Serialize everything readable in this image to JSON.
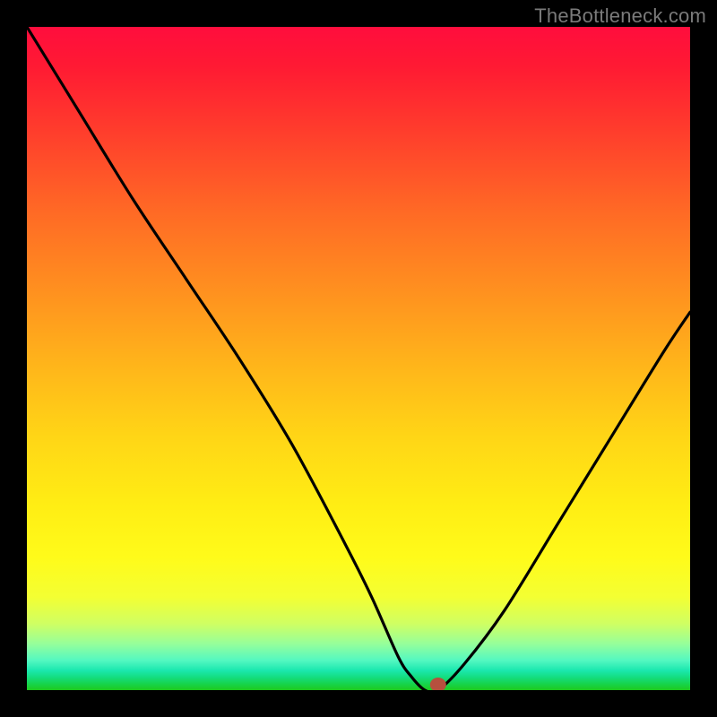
{
  "watermark": {
    "text": "TheBottleneck.com"
  },
  "chart_data": {
    "type": "line",
    "title": "",
    "xlabel": "",
    "ylabel": "",
    "xlim": [
      0,
      100
    ],
    "ylim": [
      0,
      100
    ],
    "grid": false,
    "series": [
      {
        "name": "curve",
        "x": [
          0,
          8,
          16,
          24,
          32,
          40,
          48,
          52,
          56,
          58,
          60,
          62,
          66,
          72,
          80,
          88,
          96,
          100
        ],
        "y": [
          100,
          87,
          74,
          62,
          50,
          37,
          22,
          14,
          5,
          2,
          0,
          0,
          4,
          12,
          25,
          38,
          51,
          57
        ]
      }
    ],
    "marker": {
      "x": 62,
      "y": 0
    },
    "gradient_stops": [
      {
        "pct": 0,
        "color": "#ff0d3d"
      },
      {
        "pct": 100,
        "color": "#1dca1d"
      }
    ]
  }
}
